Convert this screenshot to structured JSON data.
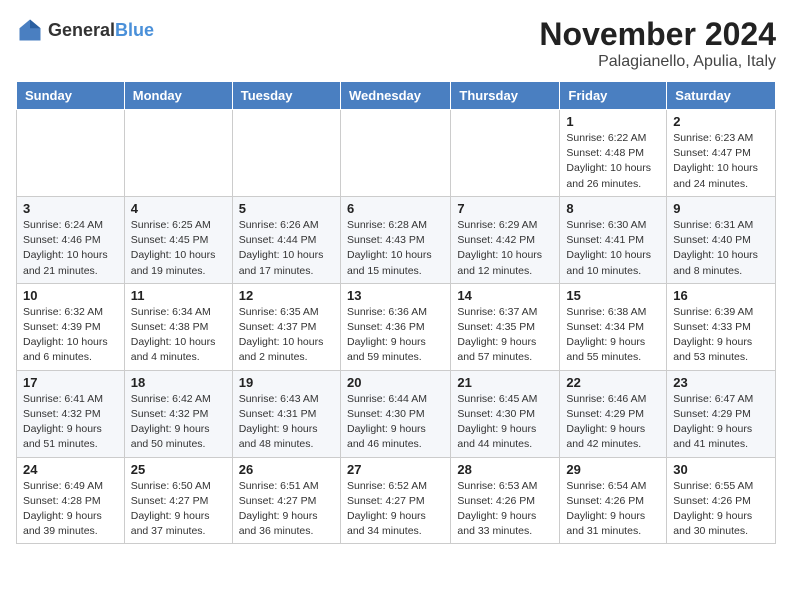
{
  "logo": {
    "general": "General",
    "blue": "Blue"
  },
  "header": {
    "month": "November 2024",
    "location": "Palagianello, Apulia, Italy"
  },
  "days_of_week": [
    "Sunday",
    "Monday",
    "Tuesday",
    "Wednesday",
    "Thursday",
    "Friday",
    "Saturday"
  ],
  "weeks": [
    [
      {
        "day": "",
        "info": ""
      },
      {
        "day": "",
        "info": ""
      },
      {
        "day": "",
        "info": ""
      },
      {
        "day": "",
        "info": ""
      },
      {
        "day": "",
        "info": ""
      },
      {
        "day": "1",
        "info": "Sunrise: 6:22 AM\nSunset: 4:48 PM\nDaylight: 10 hours and 26 minutes."
      },
      {
        "day": "2",
        "info": "Sunrise: 6:23 AM\nSunset: 4:47 PM\nDaylight: 10 hours and 24 minutes."
      }
    ],
    [
      {
        "day": "3",
        "info": "Sunrise: 6:24 AM\nSunset: 4:46 PM\nDaylight: 10 hours and 21 minutes."
      },
      {
        "day": "4",
        "info": "Sunrise: 6:25 AM\nSunset: 4:45 PM\nDaylight: 10 hours and 19 minutes."
      },
      {
        "day": "5",
        "info": "Sunrise: 6:26 AM\nSunset: 4:44 PM\nDaylight: 10 hours and 17 minutes."
      },
      {
        "day": "6",
        "info": "Sunrise: 6:28 AM\nSunset: 4:43 PM\nDaylight: 10 hours and 15 minutes."
      },
      {
        "day": "7",
        "info": "Sunrise: 6:29 AM\nSunset: 4:42 PM\nDaylight: 10 hours and 12 minutes."
      },
      {
        "day": "8",
        "info": "Sunrise: 6:30 AM\nSunset: 4:41 PM\nDaylight: 10 hours and 10 minutes."
      },
      {
        "day": "9",
        "info": "Sunrise: 6:31 AM\nSunset: 4:40 PM\nDaylight: 10 hours and 8 minutes."
      }
    ],
    [
      {
        "day": "10",
        "info": "Sunrise: 6:32 AM\nSunset: 4:39 PM\nDaylight: 10 hours and 6 minutes."
      },
      {
        "day": "11",
        "info": "Sunrise: 6:34 AM\nSunset: 4:38 PM\nDaylight: 10 hours and 4 minutes."
      },
      {
        "day": "12",
        "info": "Sunrise: 6:35 AM\nSunset: 4:37 PM\nDaylight: 10 hours and 2 minutes."
      },
      {
        "day": "13",
        "info": "Sunrise: 6:36 AM\nSunset: 4:36 PM\nDaylight: 9 hours and 59 minutes."
      },
      {
        "day": "14",
        "info": "Sunrise: 6:37 AM\nSunset: 4:35 PM\nDaylight: 9 hours and 57 minutes."
      },
      {
        "day": "15",
        "info": "Sunrise: 6:38 AM\nSunset: 4:34 PM\nDaylight: 9 hours and 55 minutes."
      },
      {
        "day": "16",
        "info": "Sunrise: 6:39 AM\nSunset: 4:33 PM\nDaylight: 9 hours and 53 minutes."
      }
    ],
    [
      {
        "day": "17",
        "info": "Sunrise: 6:41 AM\nSunset: 4:32 PM\nDaylight: 9 hours and 51 minutes."
      },
      {
        "day": "18",
        "info": "Sunrise: 6:42 AM\nSunset: 4:32 PM\nDaylight: 9 hours and 50 minutes."
      },
      {
        "day": "19",
        "info": "Sunrise: 6:43 AM\nSunset: 4:31 PM\nDaylight: 9 hours and 48 minutes."
      },
      {
        "day": "20",
        "info": "Sunrise: 6:44 AM\nSunset: 4:30 PM\nDaylight: 9 hours and 46 minutes."
      },
      {
        "day": "21",
        "info": "Sunrise: 6:45 AM\nSunset: 4:30 PM\nDaylight: 9 hours and 44 minutes."
      },
      {
        "day": "22",
        "info": "Sunrise: 6:46 AM\nSunset: 4:29 PM\nDaylight: 9 hours and 42 minutes."
      },
      {
        "day": "23",
        "info": "Sunrise: 6:47 AM\nSunset: 4:29 PM\nDaylight: 9 hours and 41 minutes."
      }
    ],
    [
      {
        "day": "24",
        "info": "Sunrise: 6:49 AM\nSunset: 4:28 PM\nDaylight: 9 hours and 39 minutes."
      },
      {
        "day": "25",
        "info": "Sunrise: 6:50 AM\nSunset: 4:27 PM\nDaylight: 9 hours and 37 minutes."
      },
      {
        "day": "26",
        "info": "Sunrise: 6:51 AM\nSunset: 4:27 PM\nDaylight: 9 hours and 36 minutes."
      },
      {
        "day": "27",
        "info": "Sunrise: 6:52 AM\nSunset: 4:27 PM\nDaylight: 9 hours and 34 minutes."
      },
      {
        "day": "28",
        "info": "Sunrise: 6:53 AM\nSunset: 4:26 PM\nDaylight: 9 hours and 33 minutes."
      },
      {
        "day": "29",
        "info": "Sunrise: 6:54 AM\nSunset: 4:26 PM\nDaylight: 9 hours and 31 minutes."
      },
      {
        "day": "30",
        "info": "Sunrise: 6:55 AM\nSunset: 4:26 PM\nDaylight: 9 hours and 30 minutes."
      }
    ]
  ]
}
